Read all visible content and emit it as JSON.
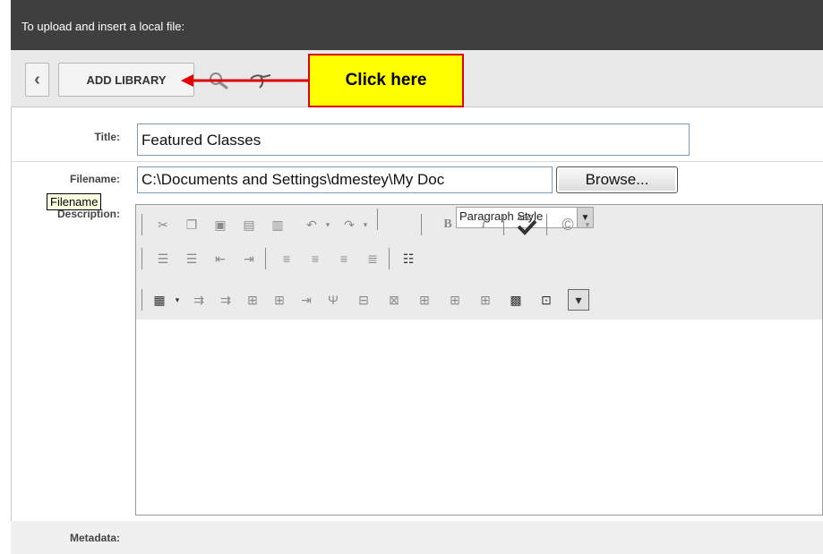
{
  "header": {
    "text": "To upload and insert a local file:"
  },
  "toolbar": {
    "back_glyph": "‹",
    "add_library_label": "ADD LIBRARY",
    "icons": [
      "search-icon",
      "link-icon"
    ]
  },
  "annotation": {
    "callout_text": "Click here",
    "arrow_color": "#e00000",
    "callout_bg": "#ffff00"
  },
  "form": {
    "title_label": "Title:",
    "title_value": "Featured Classes",
    "filename_label": "Filename:",
    "filename_value": "C:\\Documents and Settings\\dmestey\\My Doc",
    "browse_label": "Browse...",
    "tooltip_text": "Filename",
    "description_label": "Description:",
    "metadata_label": "Metadata:"
  },
  "editor": {
    "paragraph_style": "Paragraph Style",
    "row1_icons": [
      "cut-icon",
      "copy-icon",
      "paste-icon",
      "paste-word-icon",
      "paste-text-icon",
      "undo-icon",
      "redo-icon",
      "bold-icon",
      "italic-icon",
      "spellcheck-icon",
      "copyright-icon"
    ],
    "row2_icons": [
      "numbered-list-icon",
      "bulleted-list-icon",
      "outdent-icon",
      "indent-icon",
      "align-left-icon",
      "align-center-icon",
      "align-right-icon",
      "justify-icon",
      "line-spacing-icon"
    ],
    "row3_icons": [
      "table-icon",
      "insert-col-before-icon",
      "insert-col-after-icon",
      "insert-row-before-icon",
      "insert-row-after-icon",
      "delete-col-icon",
      "delete-row-icon",
      "merge-cells-icon",
      "split-cells-icon",
      "cell-props-icon",
      "table-props-icon",
      "table-style-icon",
      "show-borders-icon",
      "insert-table-rows-icon"
    ]
  }
}
